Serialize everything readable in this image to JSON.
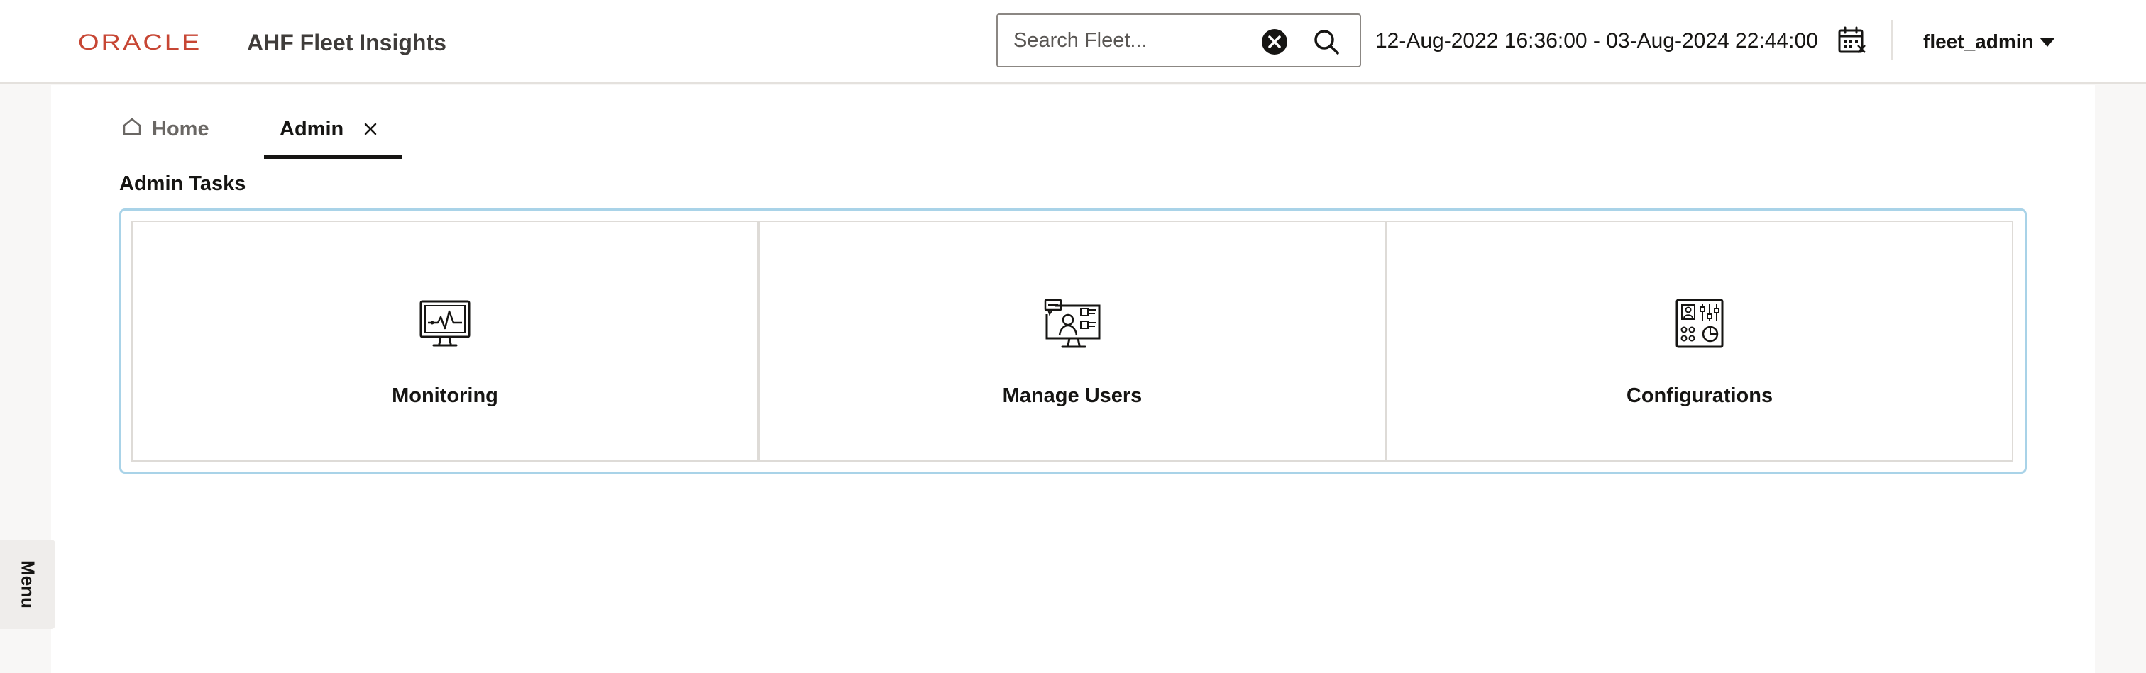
{
  "header": {
    "brand": "ORACLE",
    "app_title": "AHF Fleet Insights",
    "search": {
      "value": "",
      "placeholder": "Search Fleet..."
    },
    "date_range": "12-Aug-2022 16:36:00 - 03-Aug-2024 22:44:00",
    "user": "fleet_admin"
  },
  "tabs": [
    {
      "label": "Home",
      "active": false
    },
    {
      "label": "Admin",
      "active": true
    }
  ],
  "section_title": "Admin Tasks",
  "tasks": [
    {
      "label": "Monitoring",
      "icon": "monitor-pulse-icon"
    },
    {
      "label": "Manage Users",
      "icon": "manage-users-icon"
    },
    {
      "label": "Configurations",
      "icon": "configurations-icon"
    }
  ],
  "side_menu": {
    "label": "Menu"
  },
  "colors": {
    "brand_red": "#c74634",
    "panel_border": "#a9d3e8",
    "text_primary": "#161513",
    "background": "#f8f7f6"
  }
}
